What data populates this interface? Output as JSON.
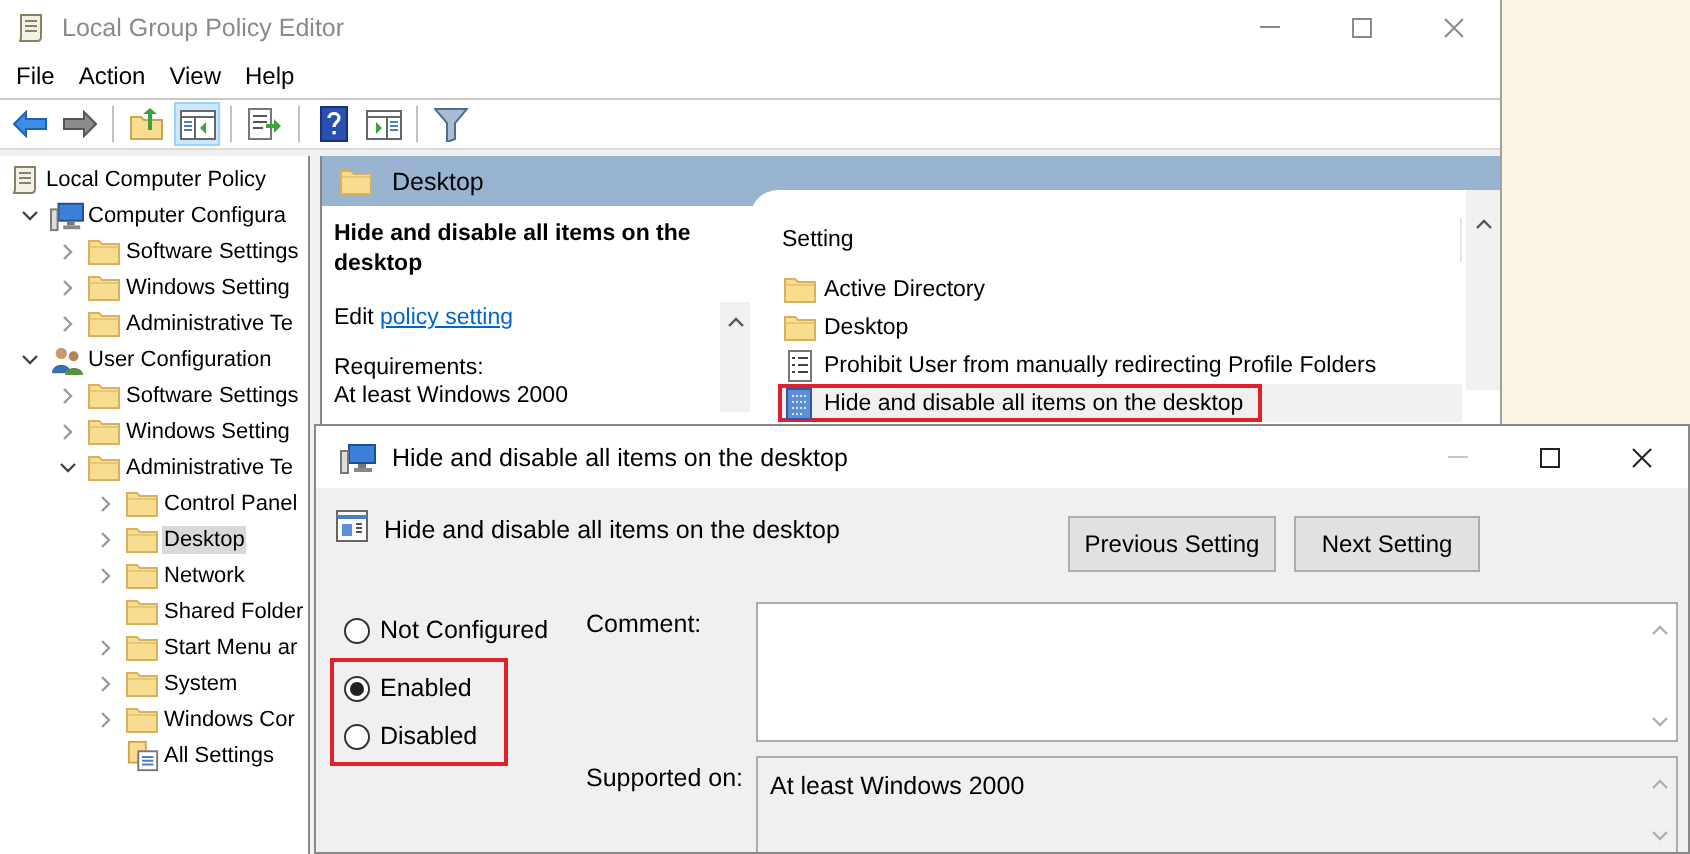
{
  "window": {
    "title": "Local Group Policy Editor"
  },
  "menu": [
    "File",
    "Action",
    "View",
    "Help"
  ],
  "toolbar": [
    [
      {
        "kind": "back",
        "pressed": false
      },
      {
        "kind": "forward",
        "pressed": false
      }
    ],
    [
      {
        "kind": "up",
        "pressed": false
      },
      {
        "kind": "tree-toggle",
        "pressed": true
      }
    ],
    [
      {
        "kind": "export",
        "pressed": false
      }
    ],
    [
      {
        "kind": "help",
        "pressed": false
      },
      {
        "kind": "pane-toggle",
        "pressed": false
      }
    ],
    [
      {
        "kind": "filter",
        "pressed": false
      }
    ]
  ],
  "tree": [
    {
      "label": "Local Computer Policy",
      "kind": "policy",
      "selected": false,
      "children": [
        {
          "label": "Computer Configura",
          "kind": "computer",
          "expanded": true,
          "selected": false,
          "children": [
            {
              "label": "Software Settings",
              "kind": "folder",
              "expanded": false,
              "selected": false
            },
            {
              "label": "Windows Setting",
              "kind": "folder",
              "expanded": false,
              "selected": false
            },
            {
              "label": "Administrative Te",
              "kind": "folder",
              "expanded": false,
              "selected": false
            }
          ]
        },
        {
          "label": "User Configuration",
          "kind": "user",
          "expanded": true,
          "selected": false,
          "children": [
            {
              "label": "Software Settings",
              "kind": "folder",
              "expanded": false,
              "selected": false
            },
            {
              "label": "Windows Setting",
              "kind": "folder",
              "expanded": false,
              "selected": false
            },
            {
              "label": "Administrative Te",
              "kind": "folder",
              "expanded": true,
              "selected": false,
              "children": [
                {
                  "label": "Control Panel",
                  "kind": "folder",
                  "expanded": false,
                  "selected": false
                },
                {
                  "label": "Desktop",
                  "kind": "folder",
                  "expanded": false,
                  "selected": true
                },
                {
                  "label": "Network",
                  "kind": "folder",
                  "expanded": false,
                  "selected": false
                },
                {
                  "label": "Shared Folder",
                  "kind": "folder",
                  "selected": false
                },
                {
                  "label": "Start Menu ar",
                  "kind": "folder",
                  "expanded": false,
                  "selected": false
                },
                {
                  "label": "System",
                  "kind": "folder",
                  "expanded": false,
                  "selected": false
                },
                {
                  "label": "Windows Cor",
                  "kind": "folder",
                  "expanded": false,
                  "selected": false
                },
                {
                  "label": "All Settings",
                  "kind": "all-settings",
                  "selected": false
                }
              ]
            }
          ]
        }
      ]
    }
  ],
  "details": {
    "header": "Desktop",
    "title": "Hide and disable all items on the desktop",
    "edit_text": "Edit",
    "edit_link": "policy setting",
    "requirements_label": "Requirements:",
    "requirements": "At least Windows 2000"
  },
  "settings": {
    "column": "Setting",
    "rows": [
      {
        "label": "Active Directory",
        "kind": "folder",
        "selected": false,
        "highlighted": false
      },
      {
        "label": "Desktop",
        "kind": "folder",
        "selected": false,
        "highlighted": false
      },
      {
        "label": "Prohibit User from manually redirecting Profile Folders",
        "kind": "setting",
        "selected": false,
        "highlighted": false
      },
      {
        "label": "Hide and disable all items on the desktop",
        "kind": "setting-active",
        "selected": true,
        "highlighted": true
      }
    ]
  },
  "dialog": {
    "title": "Hide and disable all items on the desktop",
    "setting_name": "Hide and disable all items on the desktop",
    "buttons": [
      "Previous Setting",
      "Next Setting"
    ],
    "options": [
      {
        "label": "Not Configured",
        "selected": false,
        "highlighted": false
      },
      {
        "label": "Enabled",
        "selected": true,
        "highlighted": true
      },
      {
        "label": "Disabled",
        "selected": false,
        "highlighted": true
      }
    ],
    "comment_label": "Comment:",
    "supported_label": "Supported on:",
    "supported": "At least Windows 2000"
  }
}
